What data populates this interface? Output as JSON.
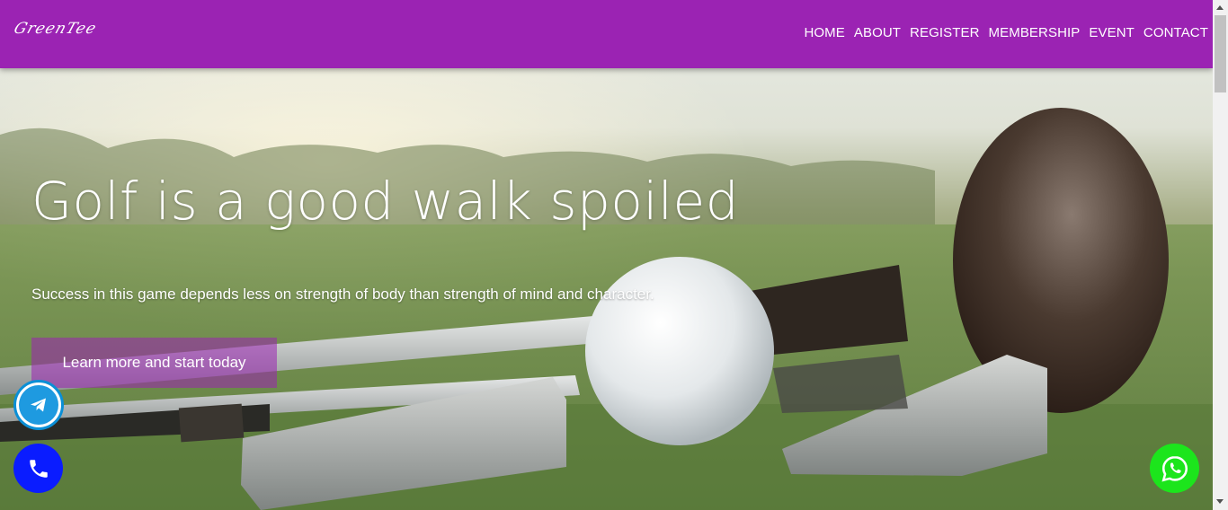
{
  "header": {
    "brand": "GreenTee",
    "background_color": "#9b23b3",
    "nav": [
      {
        "label": "HOME"
      },
      {
        "label": "ABOUT"
      },
      {
        "label": "REGISTER"
      },
      {
        "label": "MEMBERSHIP"
      },
      {
        "label": "EVENT"
      },
      {
        "label": "CONTACT"
      }
    ]
  },
  "hero": {
    "headline": "Golf is a good walk spoiled",
    "subline": "Success in this game depends less on strength of body than strength of mind and character.",
    "cta_label": "Learn more and start today",
    "cta_color": "#9b23b3",
    "background": "golf-clubs-and-ball-photo"
  },
  "floating_buttons": {
    "telegram": {
      "icon": "telegram-icon",
      "color": "#1e9ae0"
    },
    "phone": {
      "icon": "phone-icon",
      "color": "#0a1cff"
    },
    "whatsapp": {
      "icon": "whatsapp-icon",
      "color": "#1ce51c"
    }
  }
}
